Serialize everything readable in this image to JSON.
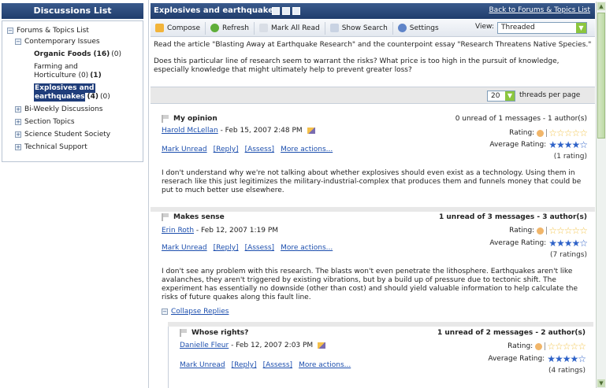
{
  "left": {
    "header": "Discussions List",
    "tree": [
      {
        "label": "Forums & Topics List",
        "sign": "⊟"
      },
      {
        "label": "Contemporary Issues",
        "sign": "⊟"
      },
      {
        "label": "Organic Foods",
        "count_bold": "(16)",
        "count": "(0)"
      },
      {
        "label": "Farming and",
        "label2": "Horticulture",
        "count": "(0)",
        "count_bold": "(1)"
      },
      {
        "label": "Explosives and",
        "label2": "earthquakes",
        "count_bold": "(4)",
        "count": "(0)"
      },
      {
        "label": "Bi-Weekly Discussions",
        "sign": "⊞"
      },
      {
        "label": "Section Topics",
        "sign": "⊞"
      },
      {
        "label": "Science Student Society",
        "sign": "⊞"
      },
      {
        "label": "Technical Support",
        "sign": "⊞"
      }
    ]
  },
  "main": {
    "title": "Explosives and earthquakes",
    "back_link": "Back to Forums & Topics List",
    "toolbar": {
      "compose": "Compose",
      "refresh": "Refresh",
      "mark_all_read": "Mark All Read",
      "show_search": "Show Search",
      "settings": "Settings",
      "view_label": "View:",
      "view_value": "Threaded"
    },
    "intro": {
      "p1": "Read the article \"Blasting Away at Earthquake Research\" and the counterpoint essay \"Research Threatens Native Species.\"",
      "p2": "Does this particular line of research seem to warrant the risks? What price is too high in the pursuit of knowledge, especially knowledge that might ultimately help to prevent greater loss?"
    },
    "threads_per_page": {
      "value": "20",
      "label": "threads per page"
    },
    "colors": {
      "header_bg": "#203d6c",
      "link": "#1d4fae",
      "select_arrow": "#8cc63f"
    }
  },
  "messages": [
    {
      "subject": "My opinion",
      "author": "Harold McLellan",
      "date": "- Feb 15, 2007 2:48 PM",
      "unread": "0 unread of 1 messages - 1 author(s)",
      "rating_label": "Rating:",
      "avg_label": "Average Rating:",
      "avg_stars": "★★★★☆",
      "rating_stars": "☆☆☆☆☆",
      "rating_count": "(1 rating)",
      "actions": [
        "Mark Unread",
        "[Reply]",
        "[Assess]",
        "More actions..."
      ],
      "body": "I don't understand why we're not talking about whether explosives should even exist as a technology. Using them in reserach like this just legitimizes the military-industrial-complex that produces them and funnels money that could be put to much better use elsewhere."
    },
    {
      "subject": "Makes sense",
      "author": "Erin Roth",
      "date": "- Feb 12, 2007 1:19 PM",
      "unread": "1 unread of 3 messages - 3 author(s)",
      "rating_label": "Rating:",
      "avg_label": "Average Rating:",
      "avg_stars": "★★★★☆",
      "rating_stars": "☆☆☆☆☆",
      "rating_count": "(7 ratings)",
      "actions": [
        "Mark Unread",
        "[Reply]",
        "[Assess]",
        "More actions..."
      ],
      "body": "I don't see any problem with this research. The blasts won't even penetrate the lithosphere. Earthquakes aren't like avalanches, they aren't triggered by existing vibrations, but by a build up of pressure due to tectonic shift. The experiment has essentially no downside (other than cost) and should yield valuable information to help calculate the risks of future quakes along this fault line.",
      "collapse": "Collapse Replies"
    },
    {
      "subject": "Whose rights?",
      "author": "Danielle Fleur",
      "date": "- Feb 12, 2007 2:03 PM",
      "unread": "1 unread of 2 messages - 2 author(s)",
      "rating_label": "Rating:",
      "avg_label": "Average Rating:",
      "avg_stars": "★★★★☆",
      "rating_stars": "☆☆☆☆☆",
      "rating_count": "(4 ratings)",
      "actions": [
        "Mark Unread",
        "[Reply]",
        "[Assess]",
        "More actions..."
      ]
    }
  ]
}
